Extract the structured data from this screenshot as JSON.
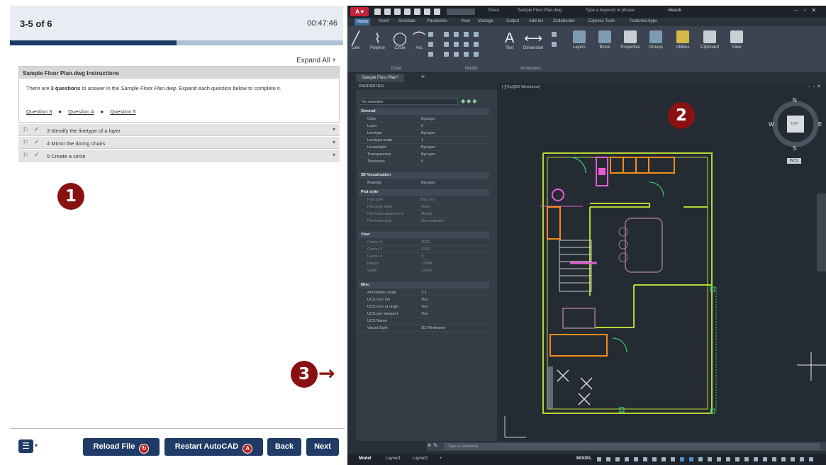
{
  "exam": {
    "counter": "3-5 of 6",
    "timer": "00:47:46",
    "progress": 0.5,
    "expand_all": "Expand All",
    "instructions": {
      "title": "Sample Floor Plan.dwg Instructions",
      "text_before": "There are ",
      "text_bold": "3 questions",
      "text_middle": " to answer in the ",
      "text_italic": "Sample Floor Plan.dwg",
      "text_after": ". Expand each question below to complete it.",
      "links": [
        "Question 3",
        "Question 4",
        "Question 5"
      ]
    },
    "questions": [
      {
        "label": "3 Identify the linetype of a layer"
      },
      {
        "label": "4 Mirror the dining chairs"
      },
      {
        "label": "5 Create a circle"
      }
    ],
    "footer": {
      "reload": "Reload File",
      "restart": "Restart AutoCAD",
      "back": "Back",
      "next": "Next"
    }
  },
  "callouts": {
    "one": "1",
    "two": "2",
    "three": "3"
  },
  "autocad": {
    "share": "Share",
    "title": "Sample Floor Plan.dwg",
    "search_placeholder": "Type a keyword or phrase",
    "user": "vikasdi",
    "ribbon_tabs": [
      "Home",
      "Insert",
      "Annotate",
      "Parametric",
      "View",
      "Manage",
      "Output",
      "Add-ins",
      "Collaborate",
      "Express Tools",
      "Featured Apps"
    ],
    "ribbon_tools": [
      "Line",
      "Polyline",
      "Circle",
      "Arc",
      "Text",
      "Dimension",
      "Layers",
      "Block",
      "Properties",
      "Groups",
      "Utilities",
      "Clipboard",
      "View"
    ],
    "ribbon_groups": [
      "Draw",
      "Modify",
      "Annotation"
    ],
    "file_tab": "Sample Floor Plan*",
    "properties": {
      "title": "PROPERTIES",
      "selection": "No selection",
      "sections": {
        "general": "General",
        "viz": "3D Visualization",
        "plot": "Plot style",
        "view": "View",
        "misc": "Misc"
      },
      "general_rows": [
        {
          "k": "Color",
          "v": "ByLayer"
        },
        {
          "k": "Layer",
          "v": "0"
        },
        {
          "k": "Linetype",
          "v": "ByLayer"
        },
        {
          "k": "Linetype scale",
          "v": "1"
        },
        {
          "k": "Lineweight",
          "v": "ByLayer"
        },
        {
          "k": "Transparency",
          "v": "ByLayer"
        },
        {
          "k": "Thickness",
          "v": "0"
        }
      ],
      "viz_rows": [
        {
          "k": "Material",
          "v": "ByLayer"
        }
      ],
      "plot_rows": [
        {
          "k": "Plot style",
          "v": "ByColor"
        },
        {
          "k": "Plot style table",
          "v": "None"
        },
        {
          "k": "Plot table attached to",
          "v": "Model"
        },
        {
          "k": "Plot table type",
          "v": "Not available"
        }
      ],
      "view_rows": [
        {
          "k": "Center X",
          "v": "3001"
        },
        {
          "k": "Center Y",
          "v": "3320"
        },
        {
          "k": "Center Z",
          "v": "0"
        },
        {
          "k": "Height",
          "v": "13984"
        },
        {
          "k": "Width",
          "v": "12090"
        }
      ],
      "misc_rows": [
        {
          "k": "Annotation scale",
          "v": "1:1"
        },
        {
          "k": "UCS icon On",
          "v": "Yes"
        },
        {
          "k": "UCS icon at origin",
          "v": "Yes"
        },
        {
          "k": "UCS per viewport",
          "v": "Yes"
        },
        {
          "k": "UCS Name",
          "v": ""
        },
        {
          "k": "Visual Style",
          "v": "2D Wireframe"
        }
      ]
    },
    "viewport_label": "[-][Top][2D Wireframe]",
    "viewcube": {
      "n": "N",
      "s": "S",
      "e": "E",
      "w": "W",
      "face": "TOP",
      "wcs": "WCS"
    },
    "cmd_placeholder": "Type a command",
    "layout_tabs": [
      "Model",
      "Layout1",
      "Layout2"
    ],
    "model_label": "MODEL"
  },
  "colors": {
    "accent": "#1f3b66",
    "callout": "#8a1111",
    "plan_wall": "#b6d335",
    "plan_furniture": "#f28c1a",
    "plan_pink": "#e55cd3",
    "plan_green": "#35c46a"
  }
}
